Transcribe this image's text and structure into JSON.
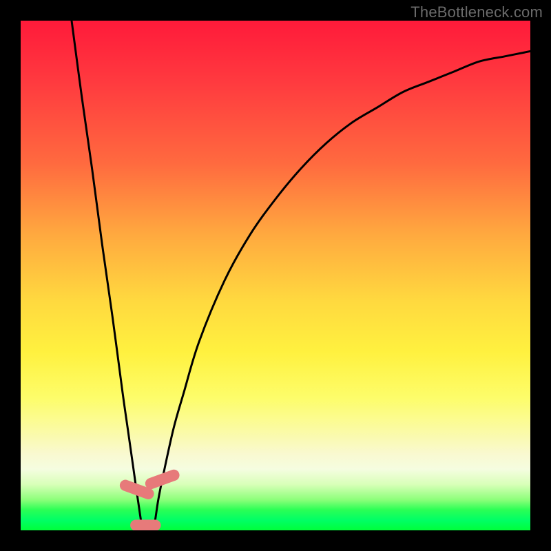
{
  "watermark": "TheBottleneck.com",
  "chart_data": {
    "type": "line",
    "title": "",
    "xlabel": "",
    "ylabel": "",
    "xlim": [
      0,
      100
    ],
    "ylim": [
      0,
      100
    ],
    "curve_minimum_x": 24,
    "grid": false,
    "legend": false,
    "gradient_stops": [
      {
        "pos": 0.0,
        "color": "#ff1a3a"
      },
      {
        "pos": 0.12,
        "color": "#ff3a3f"
      },
      {
        "pos": 0.28,
        "color": "#ff6a3f"
      },
      {
        "pos": 0.42,
        "color": "#ffa93f"
      },
      {
        "pos": 0.55,
        "color": "#ffd93f"
      },
      {
        "pos": 0.65,
        "color": "#fff13f"
      },
      {
        "pos": 0.74,
        "color": "#fdfd6a"
      },
      {
        "pos": 0.8,
        "color": "#fbfba0"
      },
      {
        "pos": 0.85,
        "color": "#f9f9d0"
      },
      {
        "pos": 0.88,
        "color": "#f5fde0"
      },
      {
        "pos": 0.91,
        "color": "#d8ffb8"
      },
      {
        "pos": 0.94,
        "color": "#8cff7a"
      },
      {
        "pos": 0.96,
        "color": "#2aff55"
      },
      {
        "pos": 0.98,
        "color": "#00ff66"
      },
      {
        "pos": 1.0,
        "color": "#00ff3a"
      }
    ],
    "series": [
      {
        "name": "bottleneck-curve",
        "x": [
          10,
          12,
          14,
          16,
          18,
          20,
          21,
          22,
          23,
          24,
          25,
          26,
          27,
          28,
          30,
          32,
          35,
          40,
          45,
          50,
          55,
          60,
          65,
          70,
          75,
          80,
          85,
          90,
          95,
          100
        ],
        "y": [
          100,
          85,
          71,
          56,
          42,
          27,
          20,
          13,
          6,
          0,
          0,
          0,
          6,
          11,
          20,
          27,
          37,
          49,
          58,
          65,
          71,
          76,
          80,
          83,
          86,
          88,
          90,
          92,
          93,
          94
        ]
      }
    ],
    "markers": [
      {
        "name": "left-marker",
        "x": 22.8,
        "y": 8,
        "w": 2.2,
        "h": 7,
        "angle": -70
      },
      {
        "name": "right-marker",
        "x": 27.8,
        "y": 10,
        "w": 2.2,
        "h": 7,
        "angle": 70
      },
      {
        "name": "bottom-marker",
        "x": 24.5,
        "y": 1,
        "w": 6,
        "h": 2.2,
        "angle": 0
      }
    ],
    "marker_color": "#e77a7a"
  }
}
